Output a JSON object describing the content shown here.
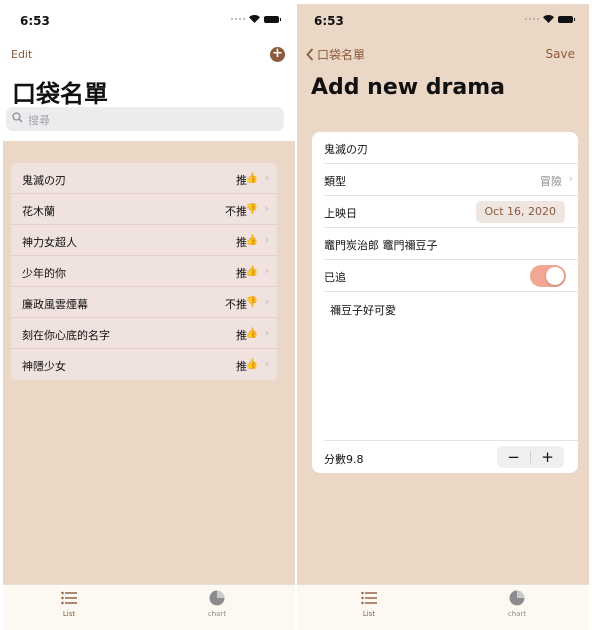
{
  "status_bar": {
    "time": "6:53"
  },
  "left": {
    "edit_label": "Edit",
    "add_label": "+",
    "title": "口袋名單",
    "search_placeholder": "搜尋",
    "rows": [
      {
        "name": "鬼滅の刃",
        "rec": "推",
        "thumb_icon": "thumbs-up-icon",
        "thumb": "👍"
      },
      {
        "name": "花木蘭",
        "rec": "不推",
        "thumb_icon": "thumbs-down-icon",
        "thumb": "👎"
      },
      {
        "name": "神力女超人",
        "rec": "推",
        "thumb_icon": "thumbs-up-icon",
        "thumb": "👍"
      },
      {
        "name": "少年的你",
        "rec": "推",
        "thumb_icon": "thumbs-up-icon",
        "thumb": "👍"
      },
      {
        "name": "廉政風雲煙幕",
        "rec": "不推",
        "thumb_icon": "thumbs-down-icon",
        "thumb": "👎"
      },
      {
        "name": "刻在你心底的名字",
        "rec": "推",
        "thumb_icon": "thumbs-up-icon",
        "thumb": "👍"
      },
      {
        "name": " 神隱少女",
        "rec": "推",
        "thumb_icon": "thumbs-up-icon",
        "thumb": "👍"
      }
    ],
    "chevron": "›"
  },
  "right": {
    "back_label": "口袋名單",
    "save_label": "Save",
    "title": "Add new drama",
    "name_value": "鬼滅の刃",
    "genre_label": "類型",
    "genre_value": "冒險",
    "release_label": "上映日",
    "release_value": "Oct 16, 2020",
    "cast_value": "竈門炭治郎 竈門禰豆子",
    "watched_label": "已追",
    "watched_on": true,
    "notes_value": "禰豆子好可愛",
    "score_label": "分數9.8",
    "stepper_minus": "−",
    "stepper_plus": "+"
  },
  "tabs": [
    {
      "label": "List",
      "icon": "list-icon",
      "active": true
    },
    {
      "label": "chart",
      "icon": "pie-chart-icon",
      "active": false
    }
  ],
  "colors": {
    "accent": "#8c5a3c",
    "background": "#ead7c6",
    "list_row": "#f0e2de",
    "toggle_on": "#f2a792"
  }
}
